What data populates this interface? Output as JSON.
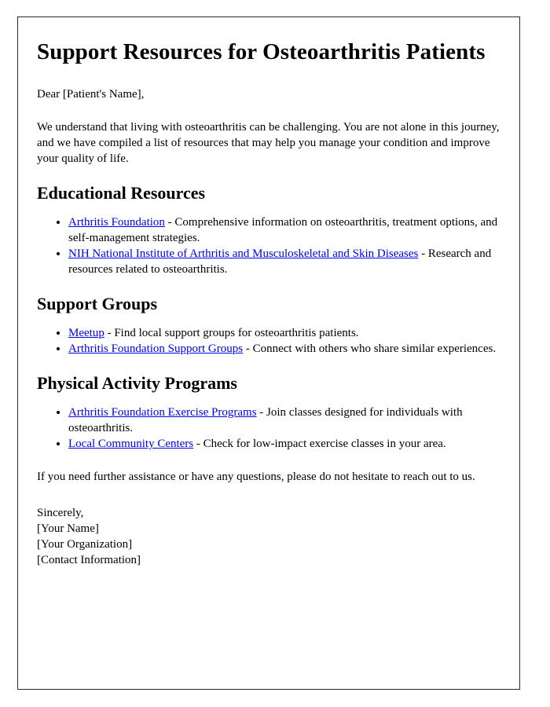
{
  "document": {
    "title": "Support Resources for Osteoarthritis Patients",
    "salutation": "Dear [Patient's Name],",
    "intro_paragraph": "We understand that living with osteoarthritis can be challenging. You are not alone in this journey, and we have compiled a list of resources that may help you manage your condition and improve your quality of life.",
    "closing_paragraph": "If you need further assistance or have any questions, please do not hesitate to reach out to us.",
    "sections": [
      {
        "heading": "Educational Resources",
        "items": [
          {
            "link": "Arthritis Foundation",
            "description": " - Comprehensive information on osteoarthritis, treatment options, and self-management strategies."
          },
          {
            "link": "NIH National Institute of Arthritis and Musculoskeletal and Skin Diseases",
            "description": " - Research and resources related to osteoarthritis."
          }
        ]
      },
      {
        "heading": "Support Groups",
        "items": [
          {
            "link": "Meetup",
            "description": " - Find local support groups for osteoarthritis patients."
          },
          {
            "link": "Arthritis Foundation Support Groups",
            "description": " - Connect with others who share similar experiences."
          }
        ]
      },
      {
        "heading": "Physical Activity Programs",
        "items": [
          {
            "link": "Arthritis Foundation Exercise Programs",
            "description": " - Join classes designed for individuals with osteoarthritis."
          },
          {
            "link": "Local Community Centers",
            "description": " - Check for low-impact exercise classes in your area."
          }
        ]
      }
    ],
    "signature": {
      "valediction": "Sincerely,",
      "name": "[Your Name]",
      "organization": "[Your Organization]",
      "contact": "[Contact Information]"
    }
  },
  "colors": {
    "link": "#0000ee",
    "text": "#000000",
    "border": "#2b2b2b",
    "background": "#ffffff"
  }
}
